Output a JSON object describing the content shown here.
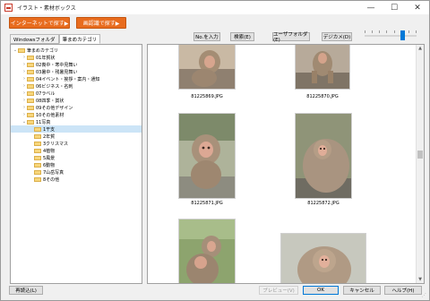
{
  "window": {
    "title": "イラスト・素材ボックス",
    "minimize_glyph": "—",
    "maximize_glyph": "☐",
    "close_glyph": "✕"
  },
  "toolbar": {
    "internet_search_label": "インターネットで探す▶",
    "image_recognition_label": "画認識で探す▶",
    "no_input_label": "No.を入力",
    "search_label": "検索(E)",
    "user_folder_label": "ユーザフォルダ(E)",
    "digicam_label": "デジカメ(D)"
  },
  "tabs": [
    {
      "label": "Windowsフォルダ",
      "active": false
    },
    {
      "label": "筆まめカテゴリ",
      "active": true
    }
  ],
  "tree": {
    "items": [
      {
        "label": "筆まめカテゴリ",
        "arrow": "⌄"
      },
      {
        "label": "01年賀状",
        "arrow": "›"
      },
      {
        "label": "02喪中・寒中見舞い",
        "arrow": "›"
      },
      {
        "label": "03暑中・残暑見舞い",
        "arrow": "›"
      },
      {
        "label": "04イベント・挨拶・案内・通知",
        "arrow": "›"
      },
      {
        "label": "06ビジネス・名刺",
        "arrow": "›"
      },
      {
        "label": "07ラベル",
        "arrow": "›"
      },
      {
        "label": "08四季・賞状",
        "arrow": "›"
      },
      {
        "label": "09その他デザイン",
        "arrow": "›"
      },
      {
        "label": "10その他素材",
        "arrow": "›"
      },
      {
        "label": "11写真",
        "arrow": "⌄"
      },
      {
        "label": "1干支",
        "arrow": ""
      },
      {
        "label": "2年賀",
        "arrow": ""
      },
      {
        "label": "3クリスマス",
        "arrow": ""
      },
      {
        "label": "4植物",
        "arrow": ""
      },
      {
        "label": "5風景",
        "arrow": ""
      },
      {
        "label": "6動物",
        "arrow": ""
      },
      {
        "label": "7山岳写真",
        "arrow": ""
      },
      {
        "label": "8その他",
        "arrow": ""
      }
    ],
    "selected_label": "1干支"
  },
  "thumbnails": [
    {
      "filename": "81225869.JPG"
    },
    {
      "filename": "81225870.JPG"
    },
    {
      "filename": "81225871.JPG"
    },
    {
      "filename": "81225872.JPG"
    },
    {
      "filename": "",
      "note_hidden": true
    },
    {
      "filename": "",
      "note_hidden": true
    }
  ],
  "footer": {
    "reload_label": "再読込(L)",
    "preview_label": "プレビュー(V)",
    "ok_label": "OK",
    "cancel_label": "キャンセル",
    "help_label": "ヘルプ(H)"
  },
  "colors": {
    "accent_orange": "#e86c1e",
    "selection_blue": "#cce4f7",
    "slider_blue": "#0078d7"
  }
}
